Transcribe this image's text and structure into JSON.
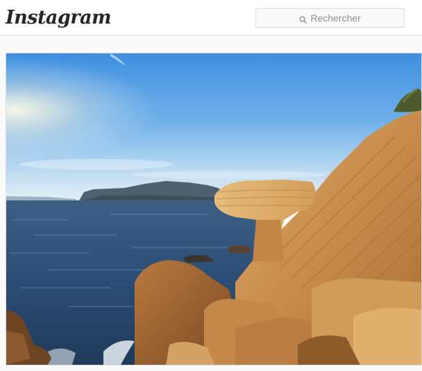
{
  "header": {
    "logo_text": "Instagram",
    "search": {
      "placeholder": "Rechercher",
      "icon": "search-icon"
    }
  },
  "post": {
    "image": {
      "subject": "coastal-cliffs-photo"
    }
  },
  "colors": {
    "text_dark": "#262626",
    "placeholder_gray": "#8e8e8e",
    "border": "#dbdbdb",
    "page_bg": "#fafafa"
  }
}
